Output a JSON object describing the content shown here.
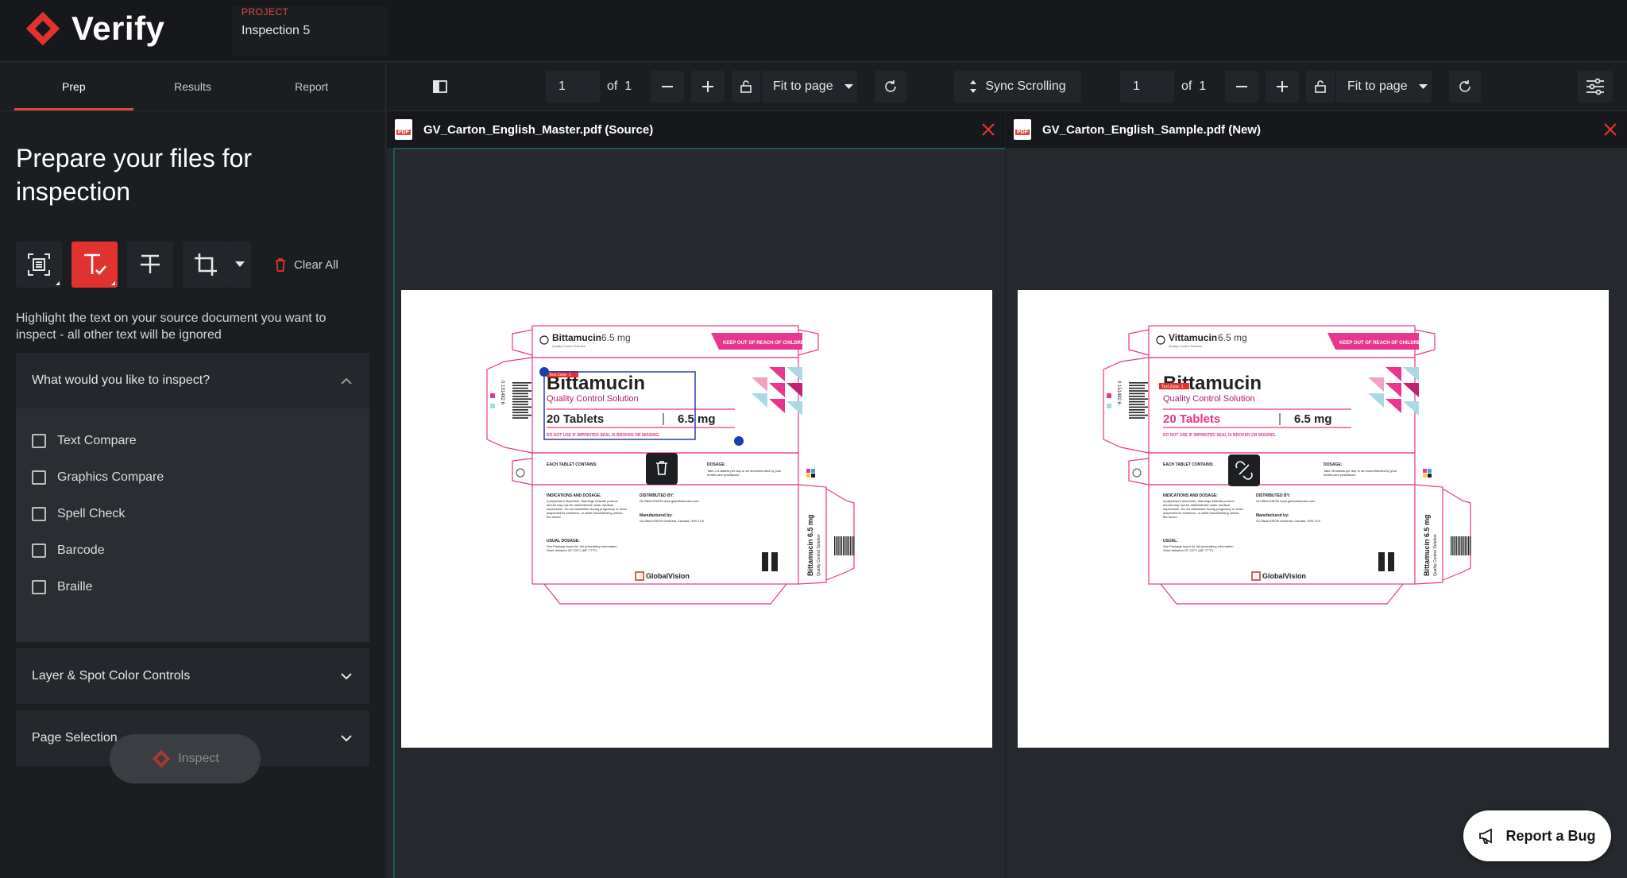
{
  "app": {
    "name": "Verify",
    "project_label": "PROJECT",
    "project_name": "Inspection 5"
  },
  "tabs": [
    "Prep",
    "Results",
    "Report"
  ],
  "left": {
    "heading": "Prepare your files for inspection",
    "clear_all": "Clear All",
    "instruction": "Highlight the text on your source document you want to inspect - all other text will be ignored",
    "inspect_section": {
      "title": "What would you like to inspect?",
      "options": [
        "Text Compare",
        "Graphics Compare",
        "Spell Check",
        "Barcode",
        "Braille"
      ]
    },
    "layer_controls": "Layer & Spot Color Controls",
    "page_selection": "Page Selection",
    "inspect_button": "Inspect"
  },
  "toolbar": {
    "left": {
      "page": "1",
      "of": "of",
      "total": "1",
      "fit": "Fit to page"
    },
    "sync": "Sync Scrolling",
    "right": {
      "page": "1",
      "of": "of",
      "total": "1",
      "fit": "Fit to page"
    }
  },
  "panes": {
    "source": {
      "filename": "GV_Carton_English_Master.pdf (Source)"
    },
    "new": {
      "filename": "GV_Carton_English_Sample.pdf (New)"
    }
  },
  "carton_source": {
    "top_name": "Bittamucin",
    "top_dose": "6.5 mg",
    "top_sub": "Quality Control Solution",
    "warning_banner": "KEEP OUT OF REACH OF CHILDREN",
    "zone_tag": "Text Zone: 1",
    "title": "Bittamucin",
    "subtitle": "Quality Control Solution",
    "tablets": "20 Tablets",
    "dose": "6.5 mg",
    "seal_warning": "DO NOT USE IF IMPRINTED SEAL IS BROKEN OR MISSING.",
    "each_tablet": "EACH TABLET CONTAINS:",
    "dosage_head": "DOSAGE:",
    "dosage_text": "Take 2-5 tablets per day or as recommended by your health care practitioner.",
    "indications_head": "INDICATIONS AND DOSAGE:",
    "indications_text": "A physician's discretion. Warnings delicate product should only use be administered under medical supervision. Do not administer during pregnancy or when suspected its existence, or while breastfeeding unless the doctor.",
    "distributed_head": "DISTRIBUTED BY:",
    "distributed_text": "GLOBALVISION www.globalvisioninc.com",
    "manufactured_head": "Manufactured by:",
    "manufactured_text": "GLOBALVISION Montreal, Canada, H9H 1C5",
    "usual_head": "USUAL DOSAGE:",
    "usual_text": "See Package Insert for full prescribing information. Store between 20°-25°C (68°-77°F).",
    "brand": "GlobalVision",
    "side_name": "Bittamucin 6.5 mg",
    "side_sub": "Quality Control Solution",
    "barcode_num": "0 151482 6"
  },
  "carton_new": {
    "top_name": "Vittamucin",
    "top_dose": "6.5 mg",
    "top_sub": "Quality Control Solution",
    "warning_banner": "KEEP OUT OF REACH OF CHILDREN",
    "zone_tag": "Text Zone: 1",
    "title": "Bittamucin",
    "subtitle": "Quality Control Solution",
    "tablets": "20 Tablets",
    "dose": "6.5 mg",
    "seal_warning": "DO NOT USE IF IMPRINTED SEAL IS BROKEN OR MISSING.",
    "each_tablet": "EACH TABLET CONTAINS:",
    "dosage_head": "DOSAGE:",
    "dosage_text": "Take 25 tablets per day or as recommended by your health care practitioner.",
    "indications_head": "INDICATIONS AND DOSAGE:",
    "indications_text": "A physician's discretion. Warnings delicate product should only use be administered under medical supervision. Do not administer during pregnancy or when suspected its existence, or while breastfeeding unless the doctor.",
    "distributed_head": "DISTRIBUTED BY:",
    "distributed_text": "GLOBALVISION www.globalvisioninc.com",
    "manufactured_head": "Manufactured by:",
    "manufactured_text": "GLOBALVISION Montreal, Canada, H9H 1C5",
    "usual_head": "USUAL:",
    "usual_text": "See Package Insert for full prescribing information. Store between 20°-25°C (68°-77°F).",
    "brand": "GlobalVision",
    "side_name": "Bittamucin 6.5 mg",
    "side_sub": "Quality Control Solution",
    "barcode_num": "0 151482 6"
  },
  "report_bug": "Report a Bug",
  "colors": {
    "accent": "#e0332f",
    "magenta": "#e8358d",
    "dark": "#16181b"
  }
}
